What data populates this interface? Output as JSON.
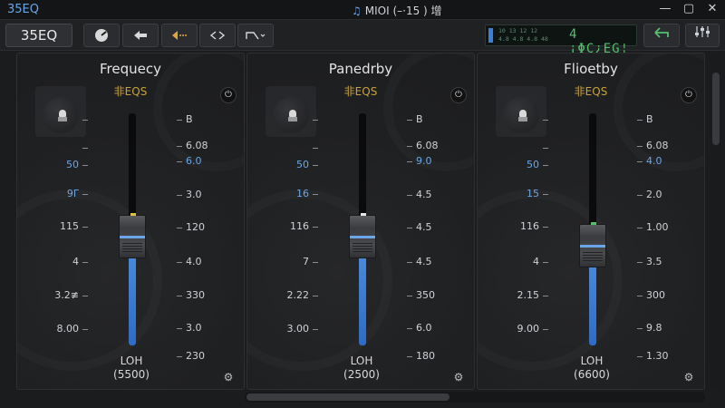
{
  "window": {
    "app_title": "35EQ",
    "center_title": "ΜΙΟΙ (–·15 ) 增",
    "center_icon": "♫",
    "minimize": "—",
    "maximize": "▢",
    "close": "✕"
  },
  "toolbar": {
    "preset_label": "35EQ",
    "display_nums": [
      "10  13  12  12",
      "4.8  4.8  4.8  48"
    ],
    "display_readout": "4 ¡ΦC¿EG¦",
    "accent": "#e0a63c",
    "display_color": "#54c06e"
  },
  "channels": [
    {
      "title": "Frequecy",
      "sub": "非EQS",
      "left_ticks": [
        "",
        "",
        "50",
        "9Γ",
        "115",
        "4",
        "3.2≢",
        "8.00"
      ],
      "right_ticks": [
        "B",
        "6.08",
        "6.0",
        "3.0",
        "120",
        "4.0",
        "330",
        "3.0",
        "230"
      ],
      "foot_1": "LOH",
      "foot_2": "(5500)",
      "level": 0.47
    },
    {
      "title": "Panedrby",
      "sub": "非EQS",
      "left_ticks": [
        "",
        "",
        "50",
        "16",
        "116",
        "7",
        "2.22",
        "3.00"
      ],
      "right_ticks": [
        "B",
        "6.08",
        "9.0",
        "4.5",
        "4.5",
        "4.5",
        "350",
        "6.0",
        "180"
      ],
      "foot_1": "LOH",
      "foot_2": "(2500)",
      "level": 0.47
    },
    {
      "title": "Flioetby",
      "sub": "非EQS",
      "left_ticks": [
        "",
        "",
        "50",
        "15",
        "116",
        "4",
        "2.15",
        "9.00"
      ],
      "right_ticks": [
        "B",
        "6.08",
        "4.0",
        "2.0",
        "1.00",
        "3.5",
        "300",
        "9.8",
        "1.30"
      ],
      "foot_1": "LOH",
      "foot_2": "(6600)",
      "level": 0.43
    }
  ],
  "colors": {
    "fader_fill": "#3f7fd6",
    "title_blue": "#6aa6e8",
    "sub_amber": "#c8a13e"
  }
}
